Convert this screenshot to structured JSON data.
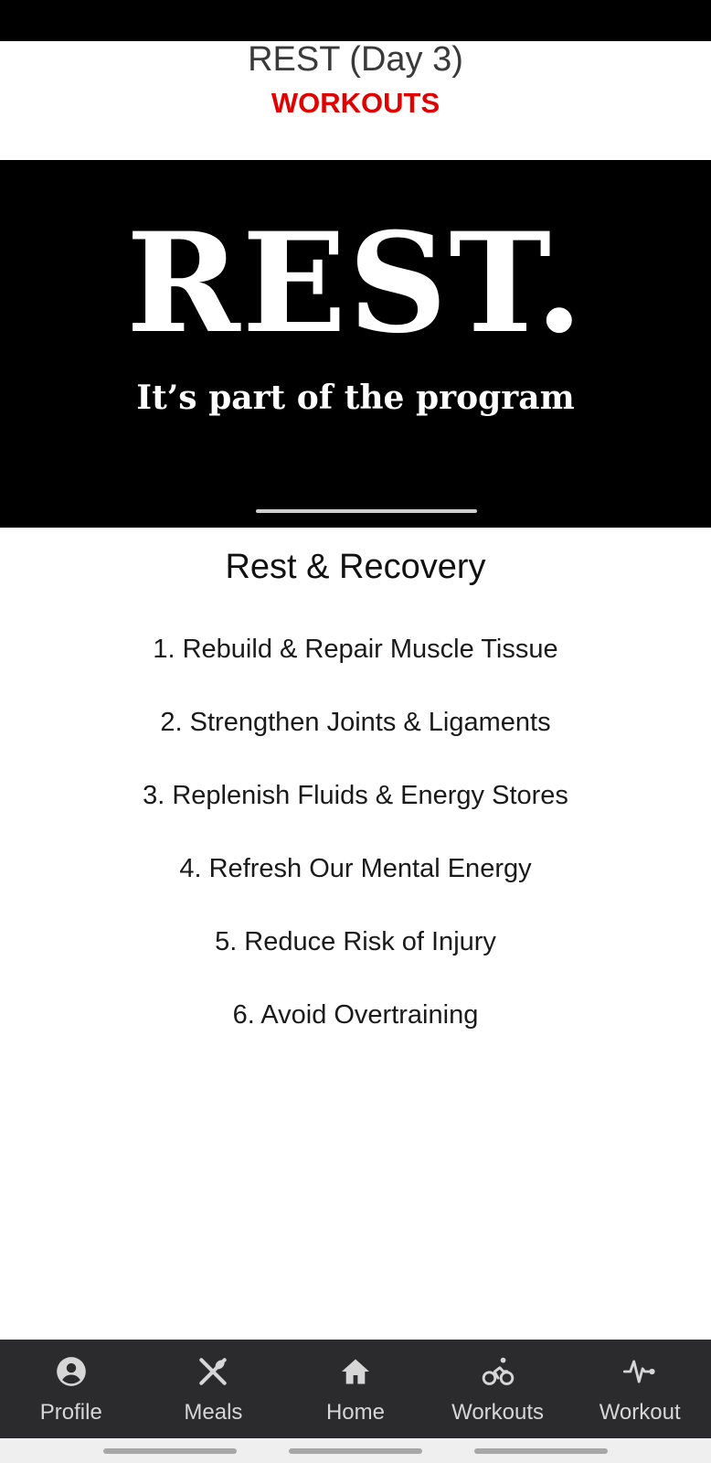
{
  "header": {
    "title": "REST (Day 3)",
    "subtitle": "WORKOUTS"
  },
  "hero": {
    "word": "REST.",
    "tagline": "It’s part of the program"
  },
  "content": {
    "section_title": "Rest & Recovery",
    "items": [
      "1. Rebuild & Repair Muscle Tissue",
      "2. Strengthen Joints & Ligaments",
      "3. Replenish Fluids & Energy Stores",
      "4. Refresh Our Mental Energy",
      "5. Reduce Risk of Injury",
      "6. Avoid Overtraining"
    ]
  },
  "bottom_nav": {
    "items": [
      {
        "label": "Profile",
        "icon": "account-circle-icon"
      },
      {
        "label": "Meals",
        "icon": "fork-knife-icon"
      },
      {
        "label": "Home",
        "icon": "home-icon"
      },
      {
        "label": "Workouts",
        "icon": "bicycle-icon"
      },
      {
        "label": "Workout",
        "icon": "heartbeat-icon"
      }
    ]
  },
  "colors": {
    "accent": "#e00000",
    "nav_background": "#2b2b2d",
    "hero_background": "#000000"
  }
}
